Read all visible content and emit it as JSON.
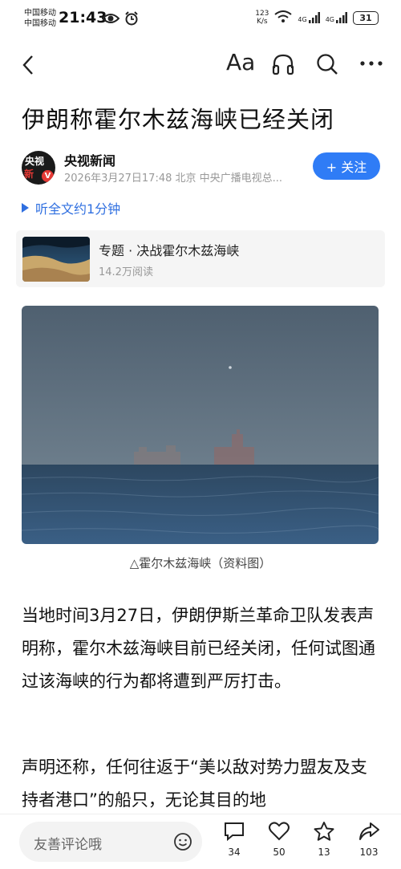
{
  "status_bar": {
    "carrier1": "中国移动",
    "carrier2": "中国移动",
    "time": "21:43",
    "net_speed_value": "123",
    "net_speed_unit": "K/s",
    "network1": "4G",
    "network2": "4G",
    "battery": "31"
  },
  "nav": {
    "font_size_label": "Aa"
  },
  "article": {
    "title": "伊朗称霍尔木兹海峡已经关闭",
    "author": "央视新闻",
    "avatar_line1": "央视",
    "avatar_line2": "新",
    "avatar_badge": "V",
    "meta": "2026年3月27日17:48 北京 中央广播电视总...",
    "follow_label": "+ 关注",
    "listen_label": "听全文约1分钟",
    "topic": {
      "title": "专题 · 决战霍尔木兹海峡",
      "reads": "14.2万阅读"
    },
    "image_caption": "△霍尔木兹海峡（资料图）",
    "paragraphs": [
      "当地时间3月27日，伊朗伊斯兰革命卫队发表声明称，霍尔木兹海峡目前已经关闭，任何试图通过该海峡的行为都将遭到严厉打击。",
      "声明还称，任何往返于“美以敌对势力盟友及支持者港口”的船只，无论其目的地"
    ]
  },
  "bottom_bar": {
    "comment_placeholder": "友善评论哦",
    "comments_count": "34",
    "likes_count": "50",
    "favorites_count": "13",
    "shares_count": "103"
  },
  "colors": {
    "accent": "#2f7cf6",
    "sea_top": "#596c7c",
    "sea_bottom": "#1f3f60"
  }
}
